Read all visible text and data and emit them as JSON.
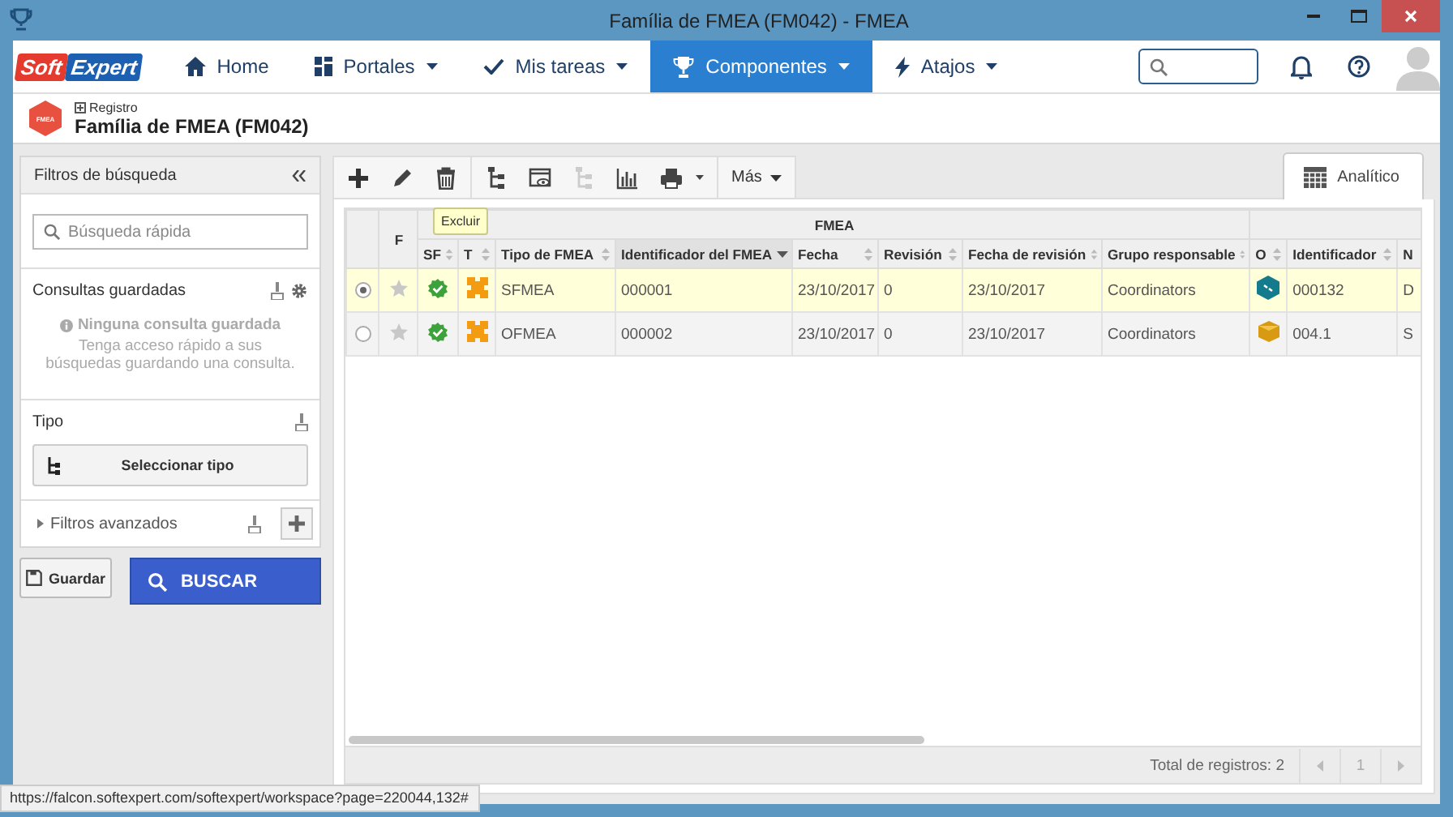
{
  "window": {
    "title": "Família de FMEA (FM042) - FMEA"
  },
  "nav": {
    "logo": {
      "left": "Soft",
      "right": "Expert"
    },
    "items": [
      {
        "label": "Home",
        "dropdown": false,
        "selected": false
      },
      {
        "label": "Portales",
        "dropdown": true,
        "selected": false
      },
      {
        "label": "Mis tareas",
        "dropdown": true,
        "selected": false
      },
      {
        "label": "Componentes",
        "dropdown": true,
        "selected": true
      },
      {
        "label": "Atajos",
        "dropdown": true,
        "selected": false
      }
    ]
  },
  "header": {
    "badge": "FMEA",
    "breadcrumb": "Registro",
    "title": "Família de FMEA (FM042)"
  },
  "filters": {
    "title": "Filtros de búsqueda",
    "search": {
      "placeholder": "Búsqueda rápida"
    },
    "saved_queries": {
      "title": "Consultas guardadas",
      "empty_title": "Ninguna consulta guardada",
      "empty_text": "Tenga acceso rápido a sus búsquedas guardando una consulta."
    },
    "type": {
      "title": "Tipo",
      "button": "Seleccionar tipo"
    },
    "advanced": {
      "title": "Filtros avanzados",
      "expanded": false
    },
    "save_button": "Guardar",
    "search_button": "BUSCAR"
  },
  "toolbar": {
    "more": "Más",
    "tooltip": "Excluir",
    "view_tab": {
      "label": "Analítico",
      "selected": true
    }
  },
  "grid": {
    "favorite_column": "F",
    "groups": [
      {
        "label": "FMEA",
        "columns": [
          {
            "label": "SF",
            "kind": "status",
            "sortable": true,
            "sorted": false
          },
          {
            "label": "T",
            "kind": "type",
            "sortable": true,
            "sorted": false
          },
          {
            "label": "Tipo de FMEA",
            "kind": "text",
            "sortable": true,
            "sorted": false
          },
          {
            "label": "Identificador del FMEA",
            "kind": "text",
            "sortable": true,
            "sorted": true
          },
          {
            "label": "Fecha",
            "kind": "text",
            "sortable": true,
            "sorted": false
          },
          {
            "label": "Revisión",
            "kind": "text",
            "sortable": true,
            "sorted": false
          },
          {
            "label": "Fecha de revisión",
            "kind": "text",
            "sortable": true,
            "sorted": false
          },
          {
            "label": "Grupo responsable",
            "kind": "text",
            "sortable": true,
            "sorted": false
          }
        ]
      },
      {
        "columns": [
          {
            "label": "O",
            "kind": "object",
            "sortable": true,
            "sorted": false
          },
          {
            "label": "Identificador",
            "kind": "text",
            "sortable": true,
            "sorted": false
          },
          {
            "label": "N",
            "kind": "text"
          }
        ]
      }
    ],
    "rows": [
      {
        "selected": true,
        "favorite": false,
        "object": {
          "kind": "hexagon"
        },
        "cells": [
          "SFMEA",
          "000001",
          "23/10/2017",
          "0",
          "23/10/2017",
          "Coordinators",
          "000132",
          "D"
        ]
      },
      {
        "selected": false,
        "favorite": false,
        "object": {
          "kind": "package"
        },
        "cells": [
          "OFMEA",
          "000002",
          "23/10/2017",
          "0",
          "23/10/2017",
          "Coordinators",
          "004.1",
          "S"
        ]
      }
    ],
    "total": "Total de registros: 2",
    "page": "1"
  },
  "status_url": "https://falcon.softexpert.com/softexpert/workspace?page=220044,132#"
}
